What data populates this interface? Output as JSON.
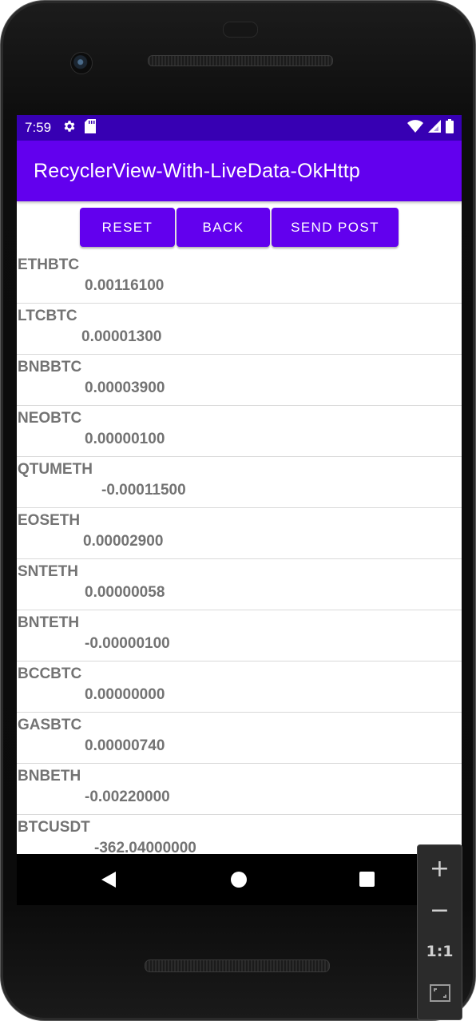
{
  "status_bar": {
    "time": "7:59",
    "icons_left": [
      "gear-icon",
      "sd-card-icon"
    ],
    "icons_right": [
      "wifi-icon",
      "signal-icon",
      "battery-icon"
    ]
  },
  "app_bar": {
    "title": "RecyclerView-With-LiveData-OkHttp"
  },
  "buttons": {
    "reset": "RESET",
    "back": "BACK",
    "send_post": "SEND POST"
  },
  "list": {
    "items": [
      {
        "symbol": "ETHBTC",
        "value": "0.00116100"
      },
      {
        "symbol": "LTCBTC",
        "value": "0.00001300"
      },
      {
        "symbol": "BNBBTC",
        "value": "0.00003900"
      },
      {
        "symbol": "NEOBTC",
        "value": "0.00000100"
      },
      {
        "symbol": "QTUMETH",
        "value": "-0.00011500"
      },
      {
        "symbol": "EOSETH",
        "value": "0.00002900"
      },
      {
        "symbol": "SNTETH",
        "value": "0.00000058"
      },
      {
        "symbol": "BNTETH",
        "value": "-0.00000100"
      },
      {
        "symbol": "BCCBTC",
        "value": "0.00000000"
      },
      {
        "symbol": "GASBTC",
        "value": "0.00000740"
      },
      {
        "symbol": "BNBETH",
        "value": "-0.00220000"
      },
      {
        "symbol": "BTCUSDT",
        "value": "-362.04000000"
      }
    ]
  },
  "nav_bar": {
    "icons": [
      "back-icon",
      "home-icon",
      "recents-icon"
    ]
  },
  "emulator_panel": {
    "zoom_in": "+",
    "zoom_out": "−",
    "actual_size": "1:1",
    "fit_icon": "fit-screen-icon"
  },
  "colors": {
    "status_bar": "#3700b3",
    "app_bar": "#6200ee",
    "button": "#6200ee",
    "list_text": "#737373"
  }
}
